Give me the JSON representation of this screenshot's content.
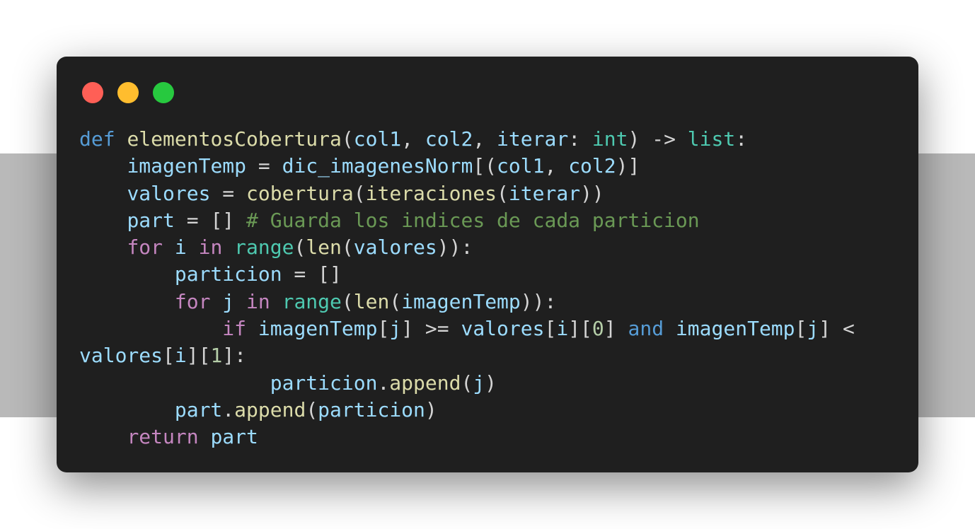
{
  "window_controls": {
    "close_color": "#ff5f56",
    "minimize_color": "#ffbd2e",
    "maximize_color": "#27c93f"
  },
  "code_lines": [
    [
      [
        "def",
        "kw"
      ],
      [
        " ",
        "pn"
      ],
      [
        "elementosCobertura",
        "fn"
      ],
      [
        "(",
        "pn"
      ],
      [
        "col1",
        "var"
      ],
      [
        ", ",
        "pn"
      ],
      [
        "col2",
        "var"
      ],
      [
        ", ",
        "pn"
      ],
      [
        "iterar",
        "var"
      ],
      [
        ": ",
        "pn"
      ],
      [
        "int",
        "ty"
      ],
      [
        ") -> ",
        "pn"
      ],
      [
        "list",
        "ty"
      ],
      [
        ":",
        "pn"
      ]
    ],
    [
      [
        "    ",
        "pn"
      ],
      [
        "imagenTemp",
        "var"
      ],
      [
        " = ",
        "pn"
      ],
      [
        "dic_imagenesNorm",
        "var"
      ],
      [
        "[(",
        "pn"
      ],
      [
        "col1",
        "var"
      ],
      [
        ", ",
        "pn"
      ],
      [
        "col2",
        "var"
      ],
      [
        ")]",
        "pn"
      ]
    ],
    [
      [
        "    ",
        "pn"
      ],
      [
        "valores",
        "var"
      ],
      [
        " = ",
        "pn"
      ],
      [
        "cobertura",
        "fn"
      ],
      [
        "(",
        "pn"
      ],
      [
        "iteraciones",
        "fn"
      ],
      [
        "(",
        "pn"
      ],
      [
        "iterar",
        "var"
      ],
      [
        "))",
        "pn"
      ]
    ],
    [
      [
        "    ",
        "pn"
      ],
      [
        "part",
        "var"
      ],
      [
        " = [] ",
        "pn"
      ],
      [
        "# Guarda los indices de cada particion",
        "cm"
      ]
    ],
    [
      [
        "    ",
        "pn"
      ],
      [
        "for",
        "ctl"
      ],
      [
        " ",
        "pn"
      ],
      [
        "i",
        "var"
      ],
      [
        " ",
        "pn"
      ],
      [
        "in",
        "ctl"
      ],
      [
        " ",
        "pn"
      ],
      [
        "range",
        "ty"
      ],
      [
        "(",
        "pn"
      ],
      [
        "len",
        "fn"
      ],
      [
        "(",
        "pn"
      ],
      [
        "valores",
        "var"
      ],
      [
        ")):",
        "pn"
      ]
    ],
    [
      [
        "        ",
        "pn"
      ],
      [
        "particion",
        "var"
      ],
      [
        " = []",
        "pn"
      ]
    ],
    [
      [
        "        ",
        "pn"
      ],
      [
        "for",
        "ctl"
      ],
      [
        " ",
        "pn"
      ],
      [
        "j",
        "var"
      ],
      [
        " ",
        "pn"
      ],
      [
        "in",
        "ctl"
      ],
      [
        " ",
        "pn"
      ],
      [
        "range",
        "ty"
      ],
      [
        "(",
        "pn"
      ],
      [
        "len",
        "fn"
      ],
      [
        "(",
        "pn"
      ],
      [
        "imagenTemp",
        "var"
      ],
      [
        ")):",
        "pn"
      ]
    ],
    [
      [
        "            ",
        "pn"
      ],
      [
        "if",
        "ctl"
      ],
      [
        " ",
        "pn"
      ],
      [
        "imagenTemp",
        "var"
      ],
      [
        "[",
        "pn"
      ],
      [
        "j",
        "var"
      ],
      [
        "] >= ",
        "pn"
      ],
      [
        "valores",
        "var"
      ],
      [
        "[",
        "pn"
      ],
      [
        "i",
        "var"
      ],
      [
        "][",
        "pn"
      ],
      [
        "0",
        "num"
      ],
      [
        "] ",
        "pn"
      ],
      [
        "and",
        "kw"
      ],
      [
        " ",
        "pn"
      ],
      [
        "imagenTemp",
        "var"
      ],
      [
        "[",
        "pn"
      ],
      [
        "j",
        "var"
      ],
      [
        "] <",
        "pn"
      ]
    ],
    [
      [
        "valores",
        "var"
      ],
      [
        "[",
        "pn"
      ],
      [
        "i",
        "var"
      ],
      [
        "][",
        "pn"
      ],
      [
        "1",
        "num"
      ],
      [
        "]:",
        "pn"
      ]
    ],
    [
      [
        "                ",
        "pn"
      ],
      [
        "particion",
        "var"
      ],
      [
        ".",
        "pn"
      ],
      [
        "append",
        "fn"
      ],
      [
        "(",
        "pn"
      ],
      [
        "j",
        "var"
      ],
      [
        ")",
        "pn"
      ]
    ],
    [
      [
        "        ",
        "pn"
      ],
      [
        "part",
        "var"
      ],
      [
        ".",
        "pn"
      ],
      [
        "append",
        "fn"
      ],
      [
        "(",
        "pn"
      ],
      [
        "particion",
        "var"
      ],
      [
        ")",
        "pn"
      ]
    ],
    [
      [
        "    ",
        "pn"
      ],
      [
        "return",
        "ctl"
      ],
      [
        " ",
        "pn"
      ],
      [
        "part",
        "var"
      ]
    ]
  ]
}
